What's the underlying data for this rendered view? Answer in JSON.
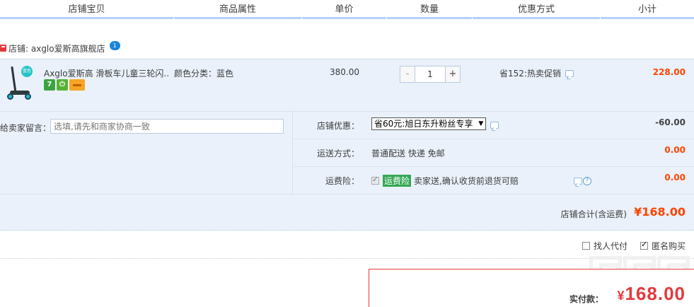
{
  "header": {
    "columns": [
      "店铺宝贝",
      "商品属性",
      "单价",
      "数量",
      "优惠方式",
      "小计"
    ]
  },
  "shop": {
    "label": "店铺: axglo爱斯高旗舰店",
    "chat_badge": "1"
  },
  "item": {
    "thumb_badge": "蓝色",
    "title": "Axglo爱斯高 滑板车儿童三轮闪...",
    "attribute": "颜色分类：蓝色",
    "price": "380.00",
    "quantity": "1",
    "minus_label": "-",
    "plus_label": "+",
    "promotion": "省152:热卖促销",
    "subtotal": "228.00",
    "service_icons": [
      "seven-day-return-icon",
      "plug-icon",
      "card-icon"
    ],
    "seven_label": "7"
  },
  "message": {
    "label": "给卖家留言：",
    "placeholder": "选填,请先和商家协商一致"
  },
  "options": {
    "discount_label": "店铺优惠：",
    "discount_select": "省60元:旭日东升粉丝专享",
    "discount_amount": "-60.00",
    "shipping_label": "运送方式：",
    "shipping_value": "普通配送 快递 免邮",
    "shipping_amount": "0.00",
    "insurance_label": "运费险：",
    "insurance_tag": "运费险",
    "insurance_text": "卖家送,确认收货前退货可赔",
    "insurance_amount": "0.00",
    "help_glyph": "?"
  },
  "total": {
    "label": "店铺合计(含运费)",
    "amount": "¥168.00"
  },
  "checkout_options": {
    "proxy_pay": "找人代付",
    "anonymous": "匿名购买",
    "anonymous_checked": true
  },
  "payment": {
    "label": "实付款：",
    "yen": "¥",
    "amount": "168.00"
  },
  "colors": {
    "accent_red": "#ff4400",
    "header_border": "#b2d1ff",
    "panel_bg": "#eaf1fa",
    "insurance_green": "#34a853"
  }
}
